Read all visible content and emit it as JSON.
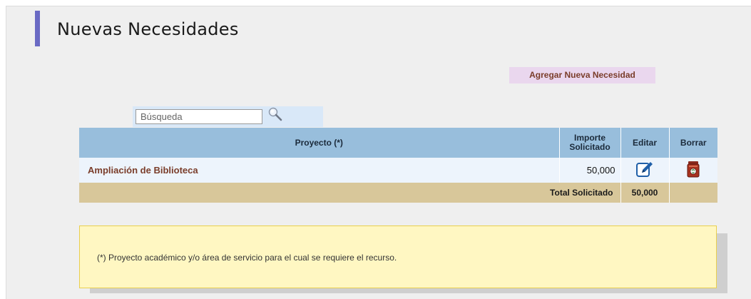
{
  "page": {
    "title": "Nuevas Necesidades",
    "add_button_label": "Agregar Nueva Necesidad"
  },
  "search": {
    "placeholder": "Búsqueda",
    "value": ""
  },
  "table": {
    "columns": {
      "project": "Proyecto (*)",
      "amount": "Importe Solicitado",
      "edit": "Editar",
      "delete": "Borrar"
    },
    "rows": [
      {
        "project": "Ampliación de Biblioteca",
        "amount": "50,000"
      }
    ],
    "total_label": "Total Solicitado",
    "total_value": "50,000"
  },
  "note": {
    "text": "(*) Proyecto académico y/o área de servicio para el cual se requiere el recurso."
  },
  "icons": {
    "search": "magnifier-icon",
    "edit": "pencil-edit-icon",
    "delete": "trash-bin-icon"
  },
  "colors": {
    "accent_bar": "#6a6ac4",
    "header_bg": "#98bedc",
    "row_bg": "#edf4fc",
    "total_bg": "#d8c79a",
    "add_button_bg": "#ead7ee",
    "link_text": "#7a3d2a",
    "note_bg": "#fff7c2"
  }
}
